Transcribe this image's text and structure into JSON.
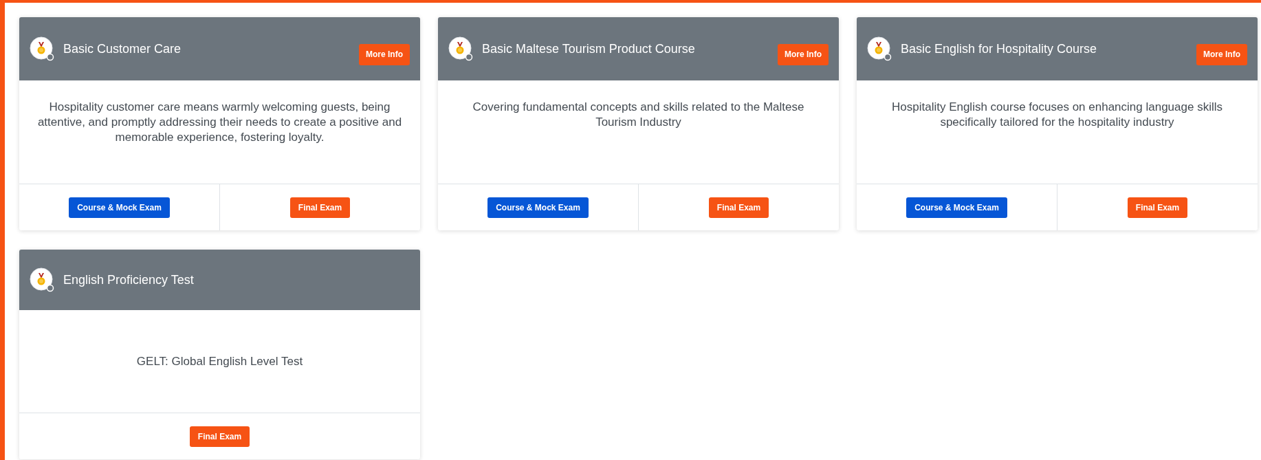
{
  "courses": [
    {
      "title": "Basic Customer Care",
      "more_info": "More Info",
      "description": "Hospitality customer care means warmly welcoming guests, being attentive, and promptly addressing their needs to create a positive and memorable experience, fostering loyalty.",
      "actions": [
        {
          "label": "Course & Mock Exam",
          "kind": "primary"
        },
        {
          "label": "Final Exam",
          "kind": "accent"
        }
      ]
    },
    {
      "title": "Basic Maltese Tourism Product Course",
      "more_info": "More Info",
      "description": "Covering fundamental concepts and skills related to the Maltese Tourism Industry",
      "actions": [
        {
          "label": "Course & Mock Exam",
          "kind": "primary"
        },
        {
          "label": "Final Exam",
          "kind": "accent"
        }
      ]
    },
    {
      "title": "Basic English for Hospitality Course",
      "more_info": "More Info",
      "description": "Hospitality English course focuses on enhancing language skills specifically tailored for the hospitality industry",
      "actions": [
        {
          "label": "Course & Mock Exam",
          "kind": "primary"
        },
        {
          "label": "Final Exam",
          "kind": "accent"
        }
      ]
    },
    {
      "title": "English Proficiency Test",
      "description": "GELT: Global English Level Test",
      "actions": [
        {
          "label": "Final Exam",
          "kind": "accent"
        }
      ]
    }
  ]
}
